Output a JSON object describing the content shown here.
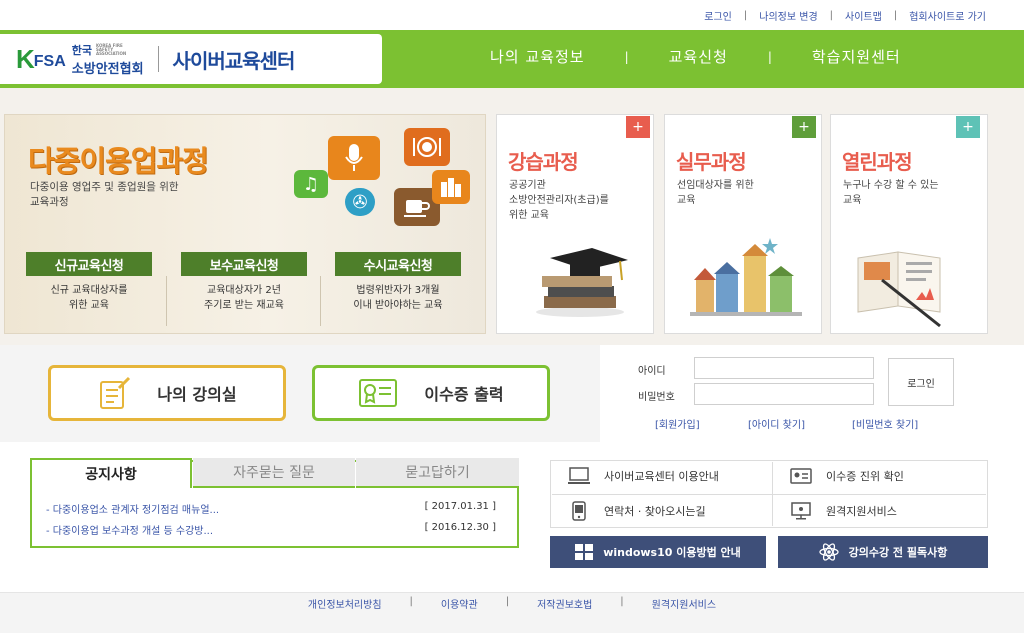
{
  "top_links": [
    "로그인",
    "나의정보 변경",
    "사이트맵",
    "협회사이트로 가기"
  ],
  "logo": {
    "k": "K",
    "fsa": "FSA",
    "org_line1": "한국",
    "org_en": "KOREA FIRE SAFETY ASSOCIATION",
    "org_line2": "소방안전협회",
    "site_title": "사이버교육센터"
  },
  "gnb": [
    "나의 교육정보",
    "교육신청",
    "학습지원센터"
  ],
  "main_banner": {
    "title": "다중이용업과정",
    "subtitle_line1": "다중이용 영업주 및 종업원을 위한",
    "subtitle_line2": "교육과정",
    "buttons": [
      {
        "label": "신규교육신청",
        "desc_line1": "신규 교육대상자를",
        "desc_line2": "위한 교육"
      },
      {
        "label": "보수교육신청",
        "desc_line1": "교육대상자가 2년",
        "desc_line2": "주기로 받는 재교육"
      },
      {
        "label": "수시교육신청",
        "desc_line1": "법령위반자가 3개월",
        "desc_line2": "이내 받아야하는 교육"
      }
    ]
  },
  "cards": [
    {
      "title": "강습과정",
      "desc_line1": "공공기관",
      "desc_line2": "소방안전관리자(초급)를",
      "desc_line3": "위한 교육",
      "plus": "+",
      "color": "#e85d4e"
    },
    {
      "title": "실무과정",
      "desc_line1": "선임대상자를 위한",
      "desc_line2": "교육",
      "desc_line3": "",
      "plus": "+",
      "color": "#5f9e3a"
    },
    {
      "title": "열린과정",
      "desc_line1": "누구나 수강 할 수 있는",
      "desc_line2": "교육",
      "desc_line3": "",
      "plus": "+",
      "color": "#5ec2b6"
    }
  ],
  "quick": {
    "my_classroom": "나의 강의실",
    "certificate": "이수증 출력"
  },
  "login": {
    "id_label": "아이디",
    "pw_label": "비밀번호",
    "id_value": "",
    "pw_value": "",
    "button": "로그인",
    "links": [
      "[회원가입]",
      "[아이디 찾기]",
      "[비밀번호 찾기]"
    ]
  },
  "tabs": [
    "공지사항",
    "자주묻는 질문",
    "묻고답하기"
  ],
  "notices": [
    {
      "title": "- 다중이용업소 관계자 정기점검 매뉴얼...",
      "date": "[ 2017.01.31 ]"
    },
    {
      "title": "- 다중이용업 보수과정 개설 등 수강방...",
      "date": "[ 2016.12.30 ]"
    }
  ],
  "services": [
    "사이버교육센터 이용안내",
    "이수증 진위 확인",
    "연락처 · 찾아오시는길",
    "원격지원서비스"
  ],
  "dark_buttons": [
    "windows10 이용방법 안내",
    "강의수강 전 필독사항"
  ],
  "footer_links": [
    "개인정보처리방침",
    "이용약관",
    "저작권보호법",
    "원격지원서비스"
  ]
}
